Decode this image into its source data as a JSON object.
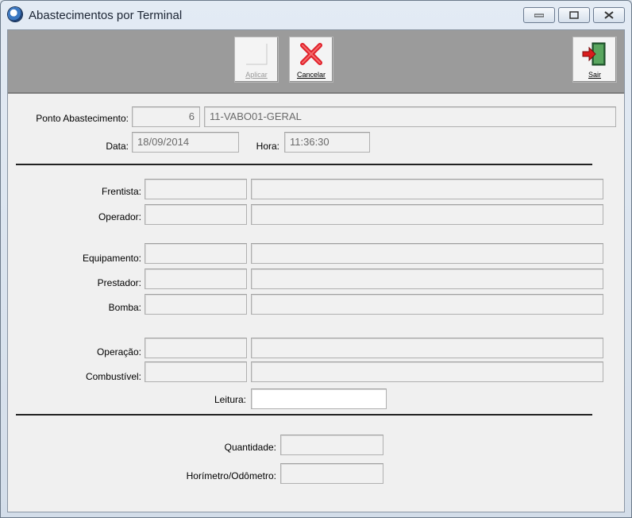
{
  "window": {
    "title": "Abastecimentos por Terminal"
  },
  "toolbar": {
    "apply_label": "Aplicar",
    "cancel_label": "Cancelar",
    "exit_label": "Sair"
  },
  "header": {
    "ponto_label": "Ponto Abastecimento:",
    "ponto_code": "6",
    "ponto_name": "11-VABO01-GERAL",
    "data_label": "Data:",
    "data_value": "18/09/2014",
    "hora_label": "Hora:",
    "hora_value": "11:36:30"
  },
  "form": {
    "frentista_label": "Frentista:",
    "operador_label": "Operador:",
    "equipamento_label": "Equipamento:",
    "prestador_label": "Prestador:",
    "bomba_label": "Bomba:",
    "operacao_label": "Operação:",
    "combustivel_label": "Combustível:",
    "leitura_label": "Leitura:",
    "leitura_value": ""
  },
  "totals": {
    "quantidade_label": "Quantidade:",
    "horimetro_label": "Horímetro/Odômetro:"
  },
  "colors": {
    "toolbar_bg": "#9b9b9b",
    "form_bg": "#f0f0f0",
    "cancel_icon": "#e0202a",
    "exit_icon": "#d91c1c"
  },
  "icons": [
    "app-logo-icon",
    "minimize-icon",
    "maximize-icon",
    "close-icon",
    "apply-icon",
    "cancel-x-icon",
    "exit-door-icon"
  ]
}
